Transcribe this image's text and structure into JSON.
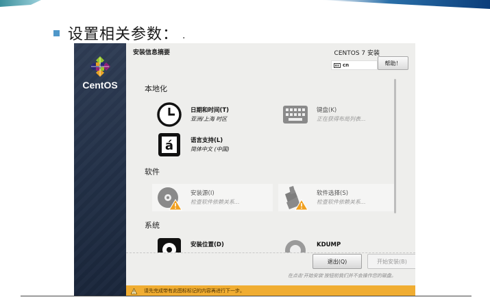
{
  "slide": {
    "title": "设置相关参数：",
    "title_dot": "."
  },
  "installer": {
    "brand": "CentOS",
    "header_title": "安装信息摘要",
    "product": "CENTOS 7 安装",
    "keyboard_layout": "cn",
    "help_label": "帮助！",
    "sections": {
      "localization": "本地化",
      "software": "软件",
      "system": "系统"
    },
    "spokes": {
      "datetime": {
        "title": "日期和时间(T)",
        "status": "亚洲/上海 时区"
      },
      "keyboard": {
        "title": "键盘(K)",
        "status": "正在获得布局列表..."
      },
      "language": {
        "title": "语言支持(L)",
        "status": "简体中文 (中国)"
      },
      "source": {
        "title": "安装源(I)",
        "status": "检查软件依赖关系..."
      },
      "selection": {
        "title": "软件选择(S)",
        "status": "检查软件依赖关系..."
      },
      "destination": {
        "title": "安装位置(D)",
        "status": ""
      },
      "kdump": {
        "title": "KDUMP",
        "status": ""
      }
    },
    "quit_label": "退出(Q)",
    "begin_label": "开始安装(B)",
    "footer_note": "在点击'开始安装'按钮前我们并不会操作您的磁盘。",
    "warning": "请先完成带有此图标标记的内容再进行下一步。"
  },
  "colors": {
    "sidebar": "#243249",
    "warning_bar": "#f0ad32",
    "bullet": "#4f97c9",
    "window_bg": "#eeeeec"
  },
  "icons": {
    "logo": "centos-logo-icon",
    "clock": "clock-icon",
    "keyboard": "keyboard-icon",
    "language": "language-icon",
    "disc": "disc-icon",
    "package": "package-icon",
    "disk": "hard-disk-icon",
    "warning": "warning-icon"
  }
}
